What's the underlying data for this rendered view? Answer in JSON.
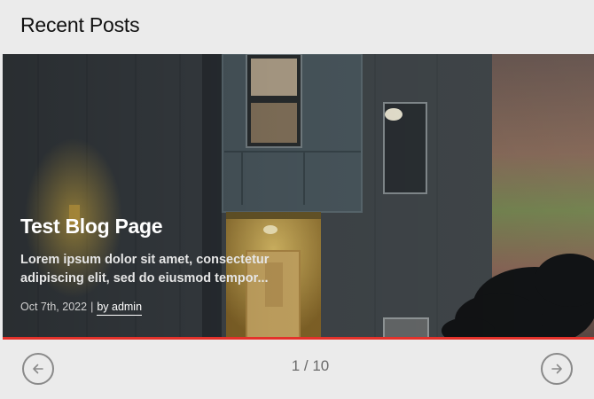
{
  "section": {
    "title": "Recent Posts"
  },
  "post": {
    "title": "Test Blog Page",
    "excerpt": "Lorem ipsum dolor sit amet, consectetur adipiscing elit, sed do eiusmod tempor...",
    "date": "Oct 7th, 2022",
    "separator": "|",
    "author": "by admin"
  },
  "pagination": {
    "counter": "1 / 10"
  },
  "icons": {
    "prev": "arrow-left-icon",
    "next": "arrow-right-icon"
  },
  "colors": {
    "accent": "#e4322b",
    "background": "#ebebeb"
  }
}
